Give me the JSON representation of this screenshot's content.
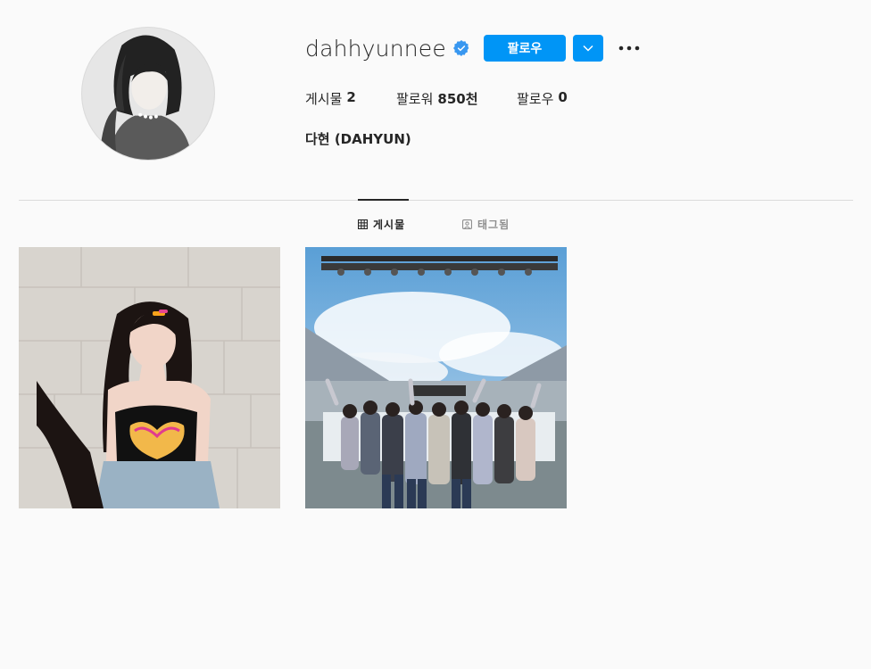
{
  "profile": {
    "username": "dahhyunnee",
    "verified": true,
    "full_name": "다현 (DAHYUN)",
    "follow_label": "팔로우",
    "avatar_icon": "profile-photo"
  },
  "stats": {
    "posts_label": "게시물",
    "posts_count": "2",
    "followers_label": "팔로워",
    "followers_count": "850천",
    "following_label": "팔로우",
    "following_count": "0"
  },
  "tabs": {
    "posts_label": "게시물",
    "tagged_label": "태그됨"
  },
  "colors": {
    "accent": "#0095f6",
    "verified": "#3897f0",
    "text": "#262626",
    "muted": "#8e8e8e",
    "background": "#fafafa",
    "divider": "#dbdbdb"
  }
}
